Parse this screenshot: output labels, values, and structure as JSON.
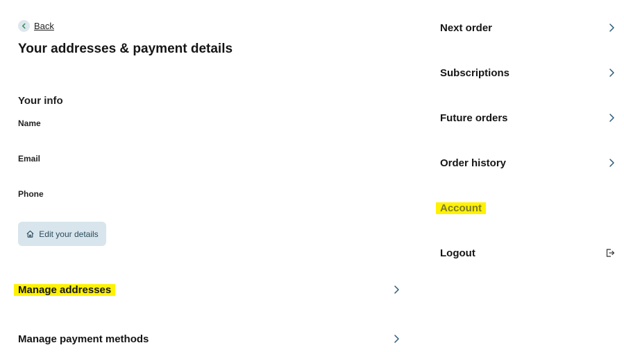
{
  "nav": {
    "back_label": "Back"
  },
  "page": {
    "title": "Your addresses & payment details"
  },
  "info": {
    "section_title": "Your info",
    "name_label": "Name",
    "email_label": "Email",
    "phone_label": "Phone",
    "edit_button_label": "Edit your details"
  },
  "manage": {
    "addresses_label": "Manage addresses",
    "payment_label": "Manage payment methods"
  },
  "menu": {
    "next_order": "Next order",
    "subscriptions": "Subscriptions",
    "future_orders": "Future orders",
    "order_history": "Order history",
    "account": "Account",
    "logout": "Logout"
  },
  "colors": {
    "highlight": "#fff200",
    "button_bg": "#d8e5ec",
    "chevron": "#2b5a78"
  }
}
